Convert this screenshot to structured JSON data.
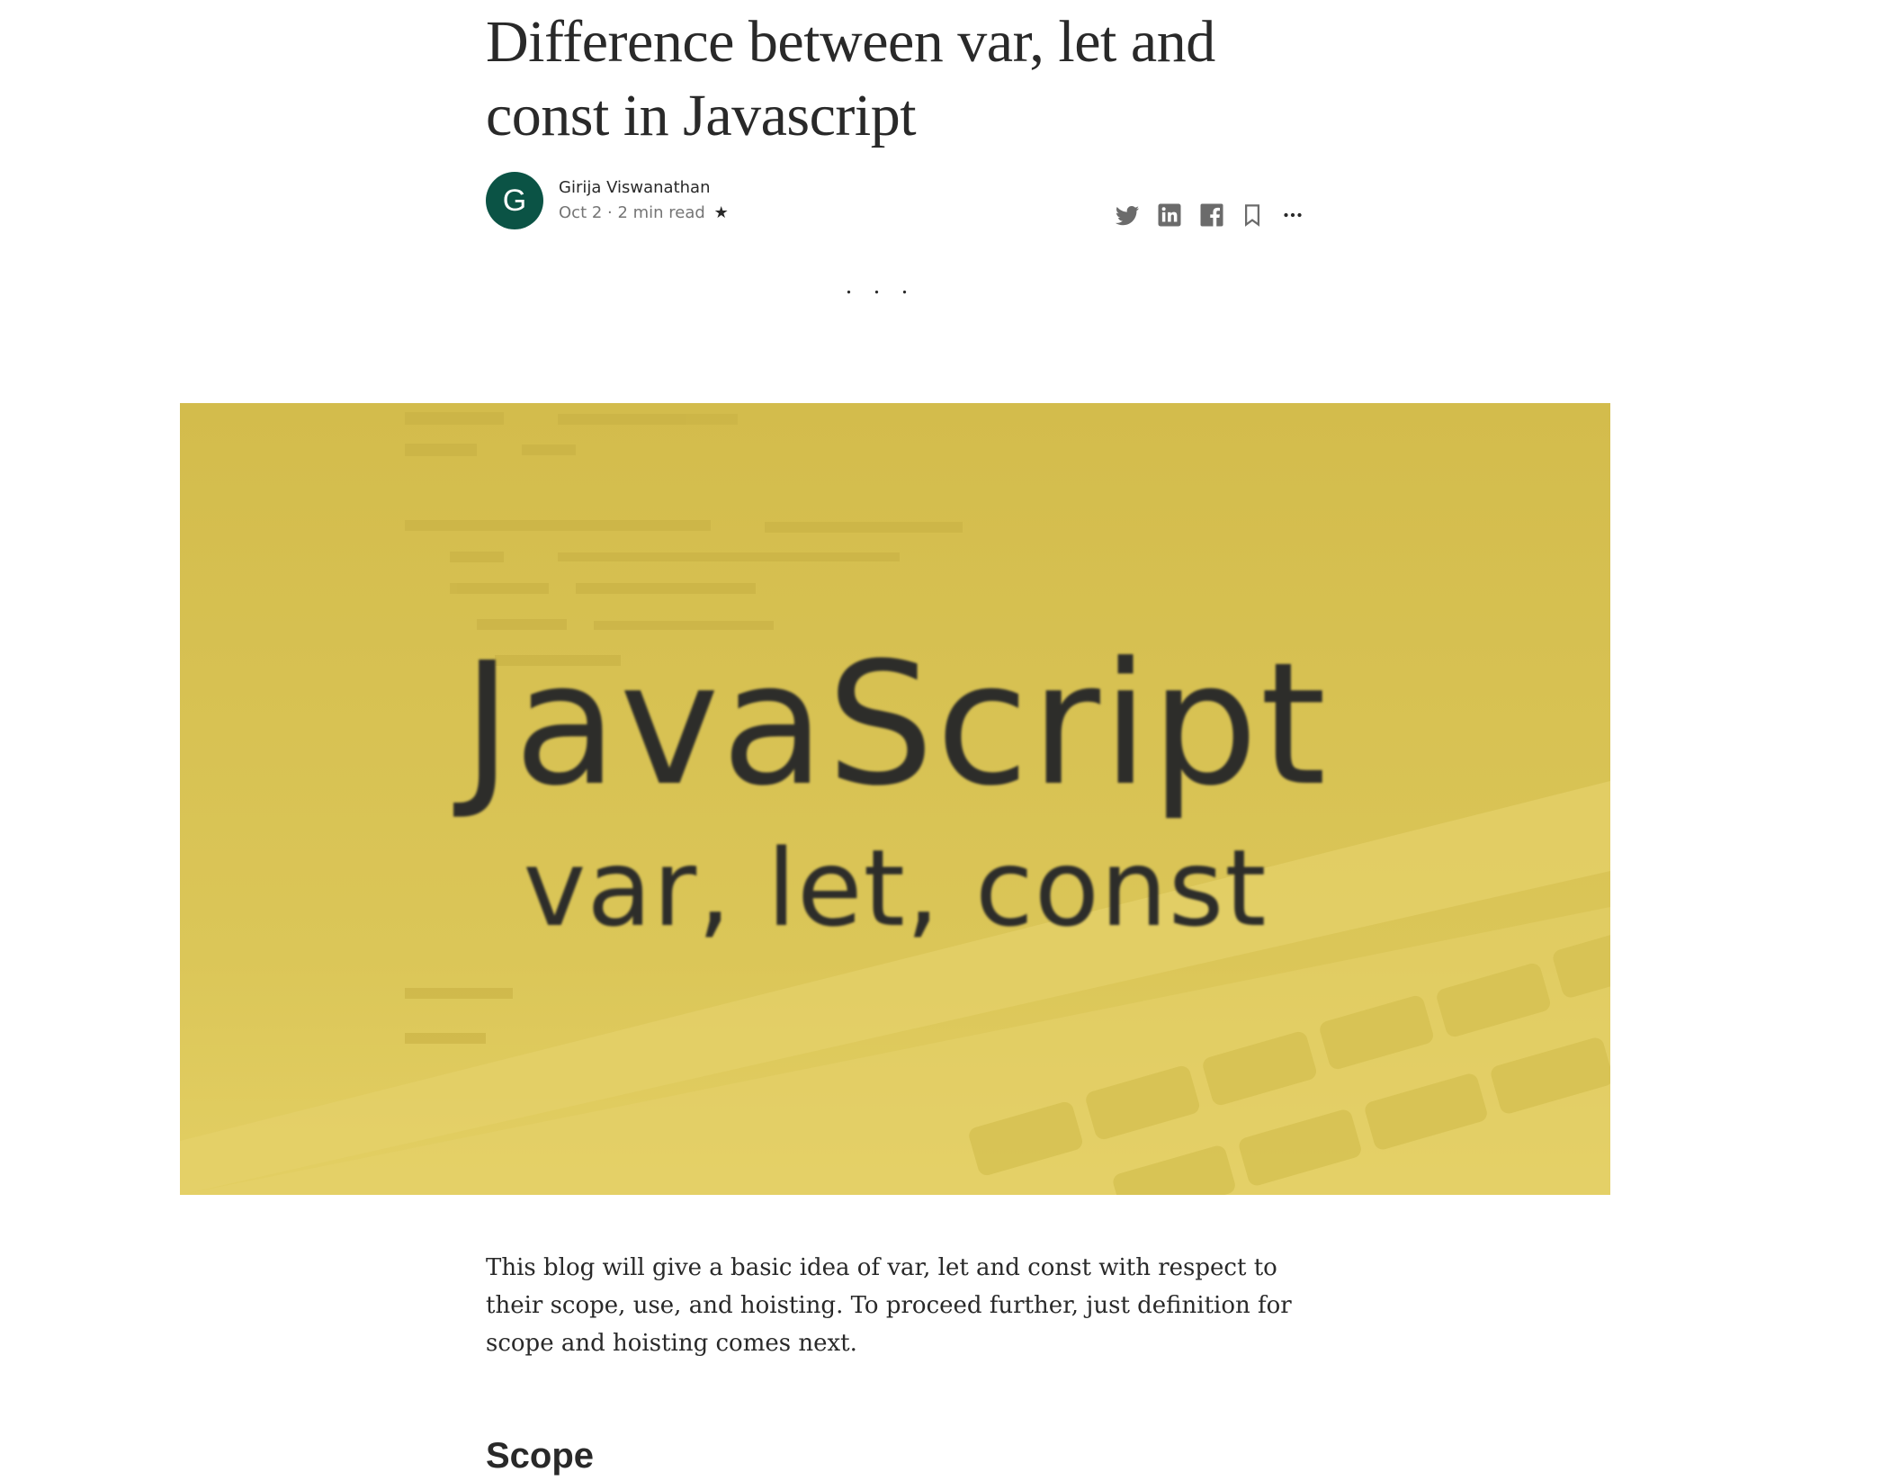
{
  "article": {
    "title": "Difference between var, let and const in Javascript",
    "author": {
      "initial": "G",
      "name": "Girija Viswanathan",
      "avatar_color": "#0b5345"
    },
    "meta": {
      "date_readtime": "Oct 2 · 2 min read",
      "member_star": "★"
    },
    "share_icons": [
      "twitter-icon",
      "linkedin-icon",
      "facebook-icon",
      "bookmark-icon",
      "more-icon"
    ],
    "separator": "...",
    "hero_image": {
      "title": "JavaScript",
      "subtitle": "var, let, const",
      "background_color": "#d4bd4f"
    },
    "intro": "This blog will give a basic idea of var, let and const with respect to their scope, use, and hoisting. To proceed further, just definition for scope and hoisting comes next.",
    "section_heading": "Scope"
  }
}
